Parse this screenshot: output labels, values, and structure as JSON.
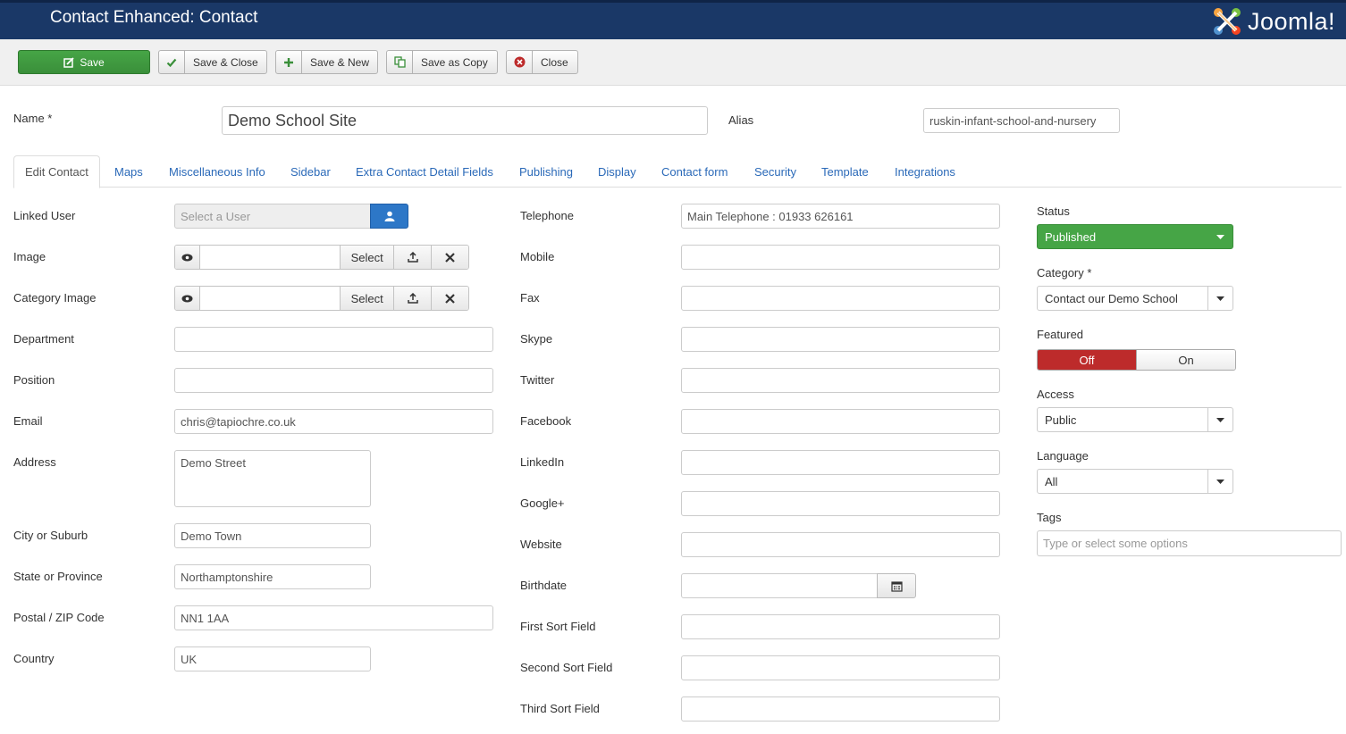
{
  "header": {
    "title": "Contact Enhanced: Contact",
    "logo_text": "Joomla!"
  },
  "toolbar": {
    "save": "Save",
    "save_close": "Save & Close",
    "save_new": "Save & New",
    "save_copy": "Save as Copy",
    "close": "Close"
  },
  "top": {
    "name_label": "Name *",
    "name_value": "Demo School Site",
    "alias_label": "Alias",
    "alias_value": "ruskin-infant-school-and-nursery"
  },
  "tabs": [
    "Edit Contact",
    "Maps",
    "Miscellaneous Info",
    "Sidebar",
    "Extra Contact Detail Fields",
    "Publishing",
    "Display",
    "Contact form",
    "Security",
    "Template",
    "Integrations"
  ],
  "left": {
    "linked_user_label": "Linked User",
    "linked_user_placeholder": "Select a User",
    "image_label": "Image",
    "category_image_label": "Category Image",
    "select_label": "Select",
    "department_label": "Department",
    "position_label": "Position",
    "email_label": "Email",
    "email_value": "chris@tapiochre.co.uk",
    "address_label": "Address",
    "address_value": "Demo Street",
    "city_label": "City or Suburb",
    "city_value": "Demo Town",
    "state_label": "State or Province",
    "state_value": "Northamptonshire",
    "postal_label": "Postal / ZIP Code",
    "postal_value": "NN1 1AA",
    "country_label": "Country",
    "country_value": "UK"
  },
  "middle": {
    "telephone_label": "Telephone",
    "telephone_value": "Main Telephone : 01933 626161",
    "mobile_label": "Mobile",
    "fax_label": "Fax",
    "skype_label": "Skype",
    "twitter_label": "Twitter",
    "facebook_label": "Facebook",
    "linkedin_label": "LinkedIn",
    "google_label": "Google+",
    "website_label": "Website",
    "birthdate_label": "Birthdate",
    "sort1_label": "First Sort Field",
    "sort2_label": "Second Sort Field",
    "sort3_label": "Third Sort Field"
  },
  "right": {
    "status_label": "Status",
    "status_value": "Published",
    "category_label": "Category *",
    "category_value": "Contact our Demo School",
    "featured_label": "Featured",
    "featured_off": "Off",
    "featured_on": "On",
    "access_label": "Access",
    "access_value": "Public",
    "language_label": "Language",
    "language_value": "All",
    "tags_label": "Tags",
    "tags_placeholder": "Type or select some options"
  },
  "colors": {
    "header": "#1a3867",
    "save": "#46a546",
    "link": "#2a69b8",
    "featured_off": "#bd2b2b",
    "user_button": "#2d77c7"
  }
}
